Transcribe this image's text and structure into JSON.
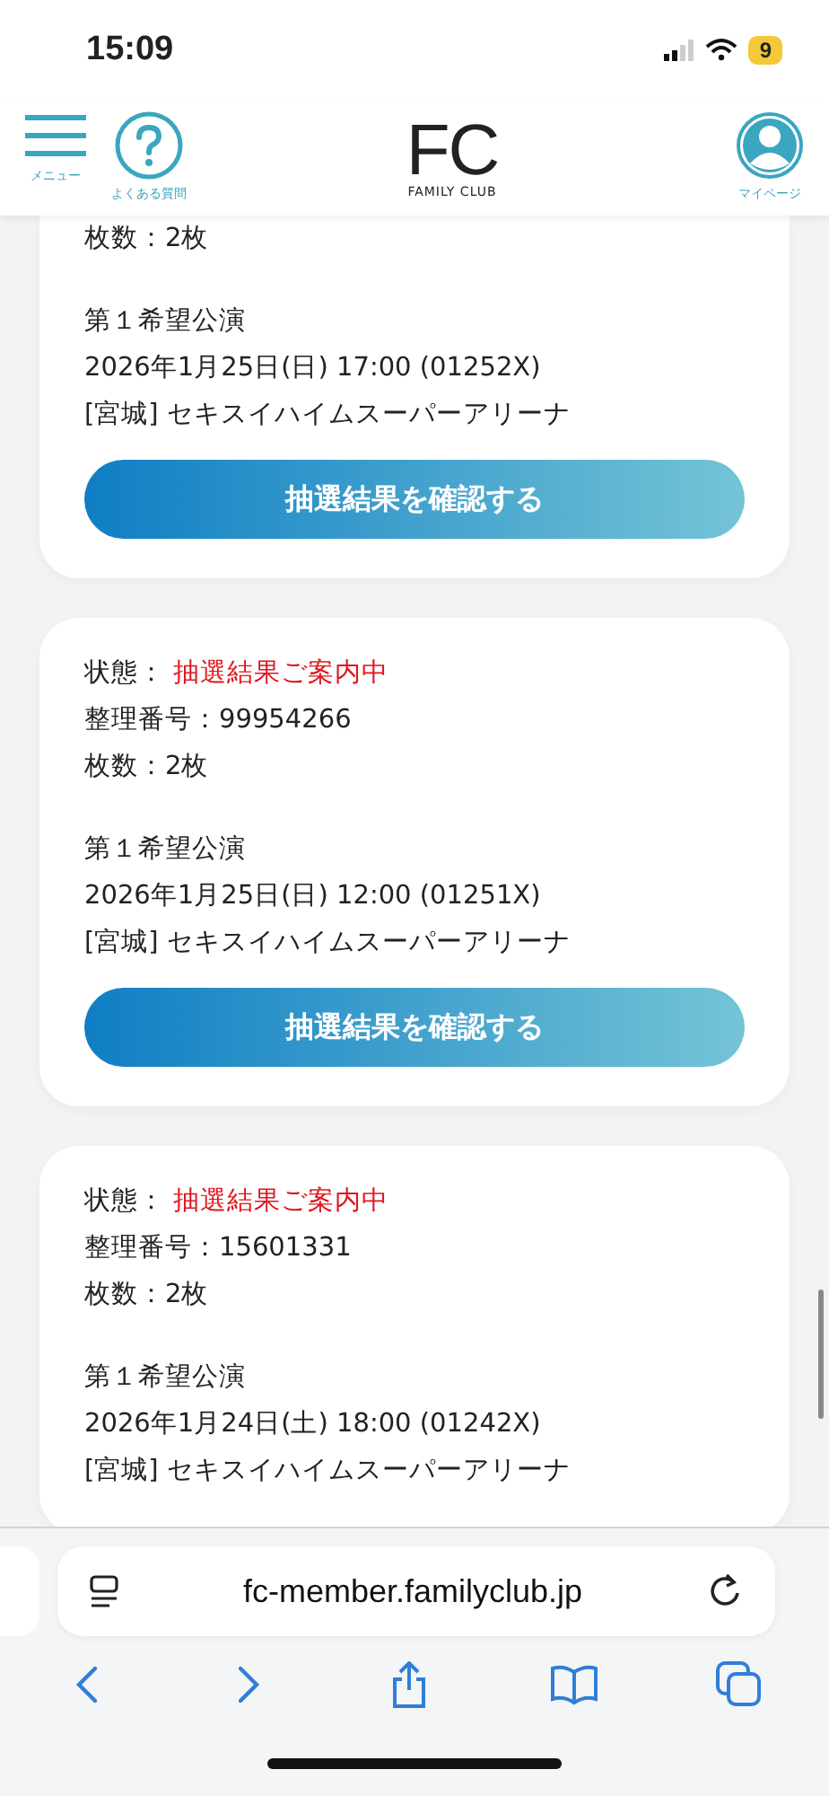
{
  "status_bar": {
    "time": "15:09",
    "battery": "9"
  },
  "header": {
    "menu_label": "メニュー",
    "faq_label": "よくある質問",
    "logo": "FC",
    "logo_sub": "FAMILY CLUB",
    "mypage_label": "マイページ"
  },
  "cards": [
    {
      "tickets": "枚数：2枚",
      "preference": "第１希望公演",
      "date": "2026年1月25日(日) 17:00 (01252X)",
      "venue": "[宮城] セキスイハイムスーパーアリーナ",
      "button": "抽選結果を確認する"
    },
    {
      "status_label": "状態：",
      "status": "抽選結果ご案内中",
      "number": "整理番号：99954266",
      "tickets": "枚数：2枚",
      "preference": "第１希望公演",
      "date": "2026年1月25日(日) 12:00 (01251X)",
      "venue": "[宮城] セキスイハイムスーパーアリーナ",
      "button": "抽選結果を確認する"
    },
    {
      "status_label": "状態：",
      "status": "抽選結果ご案内中",
      "number": "整理番号：15601331",
      "tickets": "枚数：2枚",
      "preference": "第１希望公演",
      "date": "2026年1月24日(土) 18:00 (01242X)",
      "venue": "[宮城] セキスイハイムスーパーアリーナ"
    }
  ],
  "browser": {
    "url": "fc-member.familyclub.jp"
  }
}
